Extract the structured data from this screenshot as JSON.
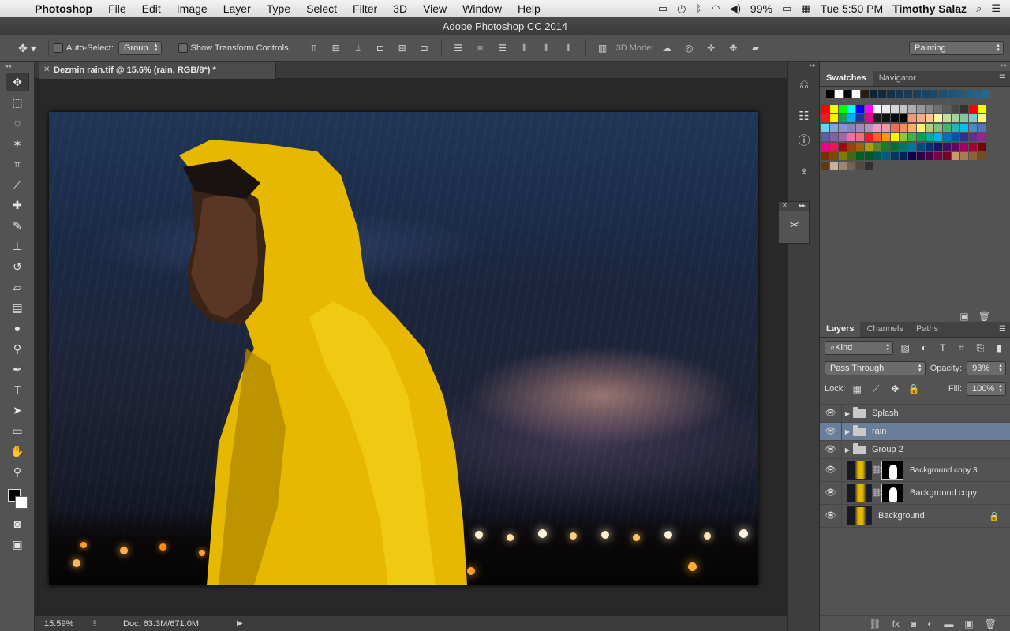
{
  "menubar": {
    "app_name": "Photoshop",
    "items": [
      "File",
      "Edit",
      "Image",
      "Layer",
      "Type",
      "Select",
      "Filter",
      "3D",
      "View",
      "Window",
      "Help"
    ],
    "battery": "99%",
    "datetime": "Tue 5:50 PM",
    "user": "Timothy Salaz"
  },
  "window": {
    "title": "Adobe Photoshop CC 2014"
  },
  "options": {
    "auto_select_label": "Auto-Select:",
    "auto_select_value": "Group",
    "show_transform_label": "Show Transform Controls",
    "mode_3d_label": "3D Mode:",
    "workspace": "Painting"
  },
  "document": {
    "tab_title": "Dezmin rain.tif @ 15.6% (rain, RGB/8*) *",
    "zoom": "15.59%",
    "doc_info": "Doc: 63.3M/671.0M"
  },
  "swatches": {
    "tabs": [
      "Swatches",
      "Navigator"
    ],
    "recent": [
      "#000000",
      "#ffffff",
      "#000000",
      "#ffffff",
      "#2a1a10",
      "#0f2233",
      "#132a3c",
      "#16304a",
      "#173550",
      "#183a56",
      "#1a3f5c",
      "#1c4462",
      "#1d4968",
      "#1f4e6e",
      "#215374",
      "#23587a",
      "#255d80",
      "#276286",
      "#29678c"
    ],
    "grid": [
      [
        "#ff0000",
        "#ffff00",
        "#00ff00",
        "#00ffff",
        "#0000ff",
        "#ff00ff",
        "#ffffff",
        "#ebebeb",
        "#d6d6d6",
        "#c2c2c2",
        "#adadad",
        "#999999",
        "#858585",
        "#707070",
        "#5c5c5c",
        "#474747",
        "#333333",
        "#ff0000",
        "#ffff00"
      ],
      [
        "#ed1c24",
        "#ffef00",
        "#00a651",
        "#00aeef",
        "#2e3192",
        "#ec008c",
        "#1f1f1f",
        "#141414",
        "#0a0a0a",
        "#000000",
        "#f7977a",
        "#f9ad81",
        "#fdc68a",
        "#fff79a",
        "#c4df9b",
        "#a3d39c",
        "#82ca9d",
        "#7bcdc8",
        "#ffff80"
      ],
      [
        "#6ecff6",
        "#7ea7d8",
        "#8493ca",
        "#8882be",
        "#a187be",
        "#bc8dbf",
        "#f49ac2",
        "#f6989d",
        "#f26c4f",
        "#f68e55",
        "#fbaf5c",
        "#fff467",
        "#acd372",
        "#7cc576",
        "#3bb878",
        "#1abbb4",
        "#00bff3",
        "#438ccb",
        "#5574b9"
      ],
      [
        "#605ca8",
        "#855fa8",
        "#a763a8",
        "#f06ea9",
        "#f26d7d",
        "#ed1c24",
        "#f26522",
        "#f7941d",
        "#fff200",
        "#8dc63f",
        "#39b54a",
        "#00a651",
        "#00a99d",
        "#00aeef",
        "#0072bc",
        "#0054a6",
        "#2e3192",
        "#662d91",
        "#92278f"
      ],
      [
        "#ec008c",
        "#ed145b",
        "#9e0b0f",
        "#a0410d",
        "#a36209",
        "#aba000",
        "#598527",
        "#197b30",
        "#007236",
        "#00746b",
        "#0076a3",
        "#004b80",
        "#003471",
        "#1b1464",
        "#440e62",
        "#630460",
        "#9e005d",
        "#9e0039",
        "#790000"
      ],
      [
        "#7b2e00",
        "#7d4900",
        "#827b00",
        "#406618",
        "#005e20",
        "#005826",
        "#005952",
        "#005b7f",
        "#003663",
        "#002157",
        "#0d004c",
        "#32004b",
        "#4b0049",
        "#7b0046",
        "#7a0026",
        "#c69c6d",
        "#a67c52",
        "#8c6239",
        "#754c24"
      ],
      [
        "#603913",
        "#c7b299",
        "#998675",
        "#736357",
        "#534741",
        "#362f2d"
      ]
    ]
  },
  "layers": {
    "tabs": [
      "Layers",
      "Channels",
      "Paths"
    ],
    "filter_kind": "Kind",
    "blend_mode": "Pass Through",
    "opacity_label": "Opacity:",
    "opacity": "93%",
    "lock_label": "Lock:",
    "fill_label": "Fill:",
    "fill": "100%",
    "items": [
      {
        "name": "Splash",
        "type": "group"
      },
      {
        "name": "rain",
        "type": "group"
      },
      {
        "name": "Group 2",
        "type": "group"
      },
      {
        "name": "Background copy 3",
        "type": "masked"
      },
      {
        "name": "Background copy",
        "type": "masked"
      },
      {
        "name": "Background",
        "type": "locked"
      }
    ]
  }
}
